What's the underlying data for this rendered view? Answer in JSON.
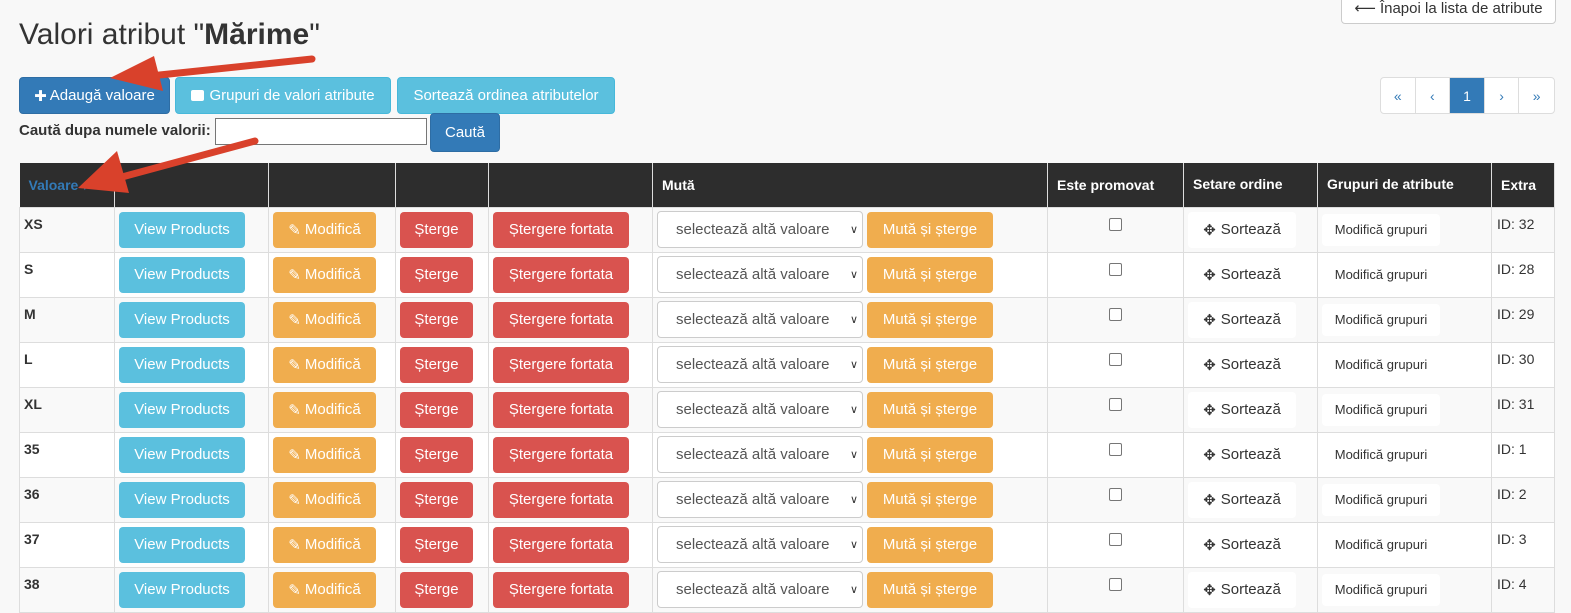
{
  "header": {
    "title_prefix": "Valori atribut \"",
    "title_attr": "Mărime",
    "title_suffix": "\"",
    "back_label": "Înapoi la lista de atribute",
    "back_icon": "arrow-left-icon"
  },
  "toolbar": {
    "add_label": "Adaugă valoare",
    "add_icon": "plus-icon",
    "groups_label": "Grupuri de valori atribute",
    "groups_icon": "briefcase-icon",
    "sort_label": "Sortează ordinea atributelor"
  },
  "search": {
    "label": "Caută dupa numele valorii:",
    "value": "",
    "button_label": "Caută"
  },
  "pagination": {
    "first": "«",
    "prev": "‹",
    "current": "1",
    "next": "›",
    "last": "»"
  },
  "table": {
    "headers": {
      "value": "Valoare",
      "move": "Mută",
      "promoted": "Este promovat",
      "order": "Setare ordine",
      "groups": "Grupuri de atribute",
      "extra": "Extra"
    },
    "row_labels": {
      "view": "View Products",
      "edit": "Modifică",
      "delete": "Șterge",
      "force_delete": "Ștergere fortata",
      "select_placeholder": "selectează altă valoare",
      "move_delete": "Mută și șterge",
      "sort": "Sortează",
      "edit_groups": "Modifică grupuri"
    },
    "rows": [
      {
        "value": "XS",
        "id": "ID: 32",
        "promoted": false
      },
      {
        "value": "S",
        "id": "ID: 28",
        "promoted": false
      },
      {
        "value": "M",
        "id": "ID: 29",
        "promoted": false
      },
      {
        "value": "L",
        "id": "ID: 30",
        "promoted": false
      },
      {
        "value": "XL",
        "id": "ID: 31",
        "promoted": false
      },
      {
        "value": "35",
        "id": "ID: 1",
        "promoted": false
      },
      {
        "value": "36",
        "id": "ID: 2",
        "promoted": false
      },
      {
        "value": "37",
        "id": "ID: 3",
        "promoted": false
      },
      {
        "value": "38",
        "id": "ID: 4",
        "promoted": false
      }
    ]
  },
  "colors": {
    "primary": "#337ab7",
    "info": "#5bc0de",
    "warning": "#f0ad4e",
    "danger": "#d9534f",
    "header_bg": "#2d2d2d",
    "annotation_arrow": "#d9412b"
  }
}
